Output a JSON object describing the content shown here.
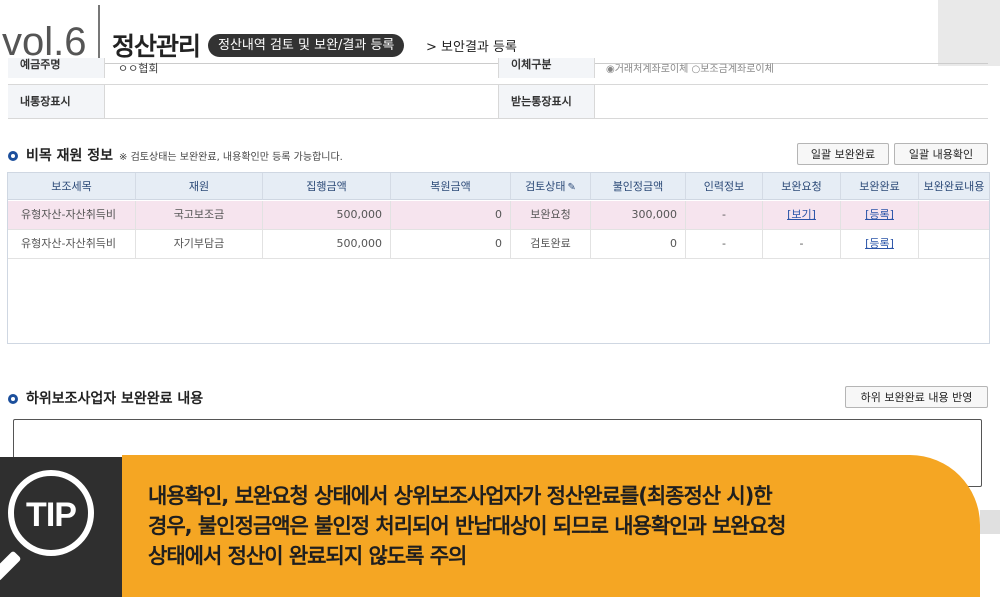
{
  "header": {
    "vol": "vol.6",
    "section": "정산관리",
    "pill": "정산내역 검토 및 보완/결과 등록",
    "crumb": "> 보안결과 등록"
  },
  "info_table": {
    "r1_label": "예금주명",
    "r1_value": "ㅇㅇ협회",
    "r1_label2": "이체구분",
    "r1_value2": "◉거래처계좌로이체 ○보조금계좌로이체",
    "r2_label": "내통장표시",
    "r2_value": "",
    "r2_label2": "받는통장표시",
    "r2_value2": ""
  },
  "budget_section": {
    "title": "비목 재원 정보",
    "note": "※ 검토상태는 보완완료, 내용확인만 등록 가능합니다.",
    "btn_bulk_complete": "일괄 보완완료",
    "btn_bulk_confirm": "일괄 내용확인",
    "columns": [
      "보조세목",
      "재원",
      "집행금액",
      "복원금액",
      "검토상태",
      "불인정금액",
      "인력정보",
      "보완요청",
      "보완완료",
      "보완완료내용"
    ],
    "sort_icon": "edit-icon",
    "rows": [
      {
        "subitem": "유형자산-자산취득비",
        "source": "국고보조금",
        "exec": "500,000",
        "restore": "0",
        "status": "보완요청",
        "disallowed": "300,000",
        "personnel": "-",
        "request": "[보기]",
        "complete": "[등록]",
        "content": ""
      },
      {
        "subitem": "유형자산-자산취득비",
        "source": "자기부담금",
        "exec": "500,000",
        "restore": "0",
        "status": "검토완료",
        "disallowed": "0",
        "personnel": "-",
        "request": "-",
        "complete": "[등록]",
        "content": ""
      }
    ],
    "highlight_color": "#f6e4ee"
  },
  "sub_section": {
    "title": "하위보조사업자 보완완료 내용",
    "btn_apply": "하위 보완완료 내용 반영"
  },
  "tip": {
    "badge": "TIP",
    "line1": "내용확인, 보완요청 상태에서 상위보조사업자가 정산완료를(최종정산 시)한",
    "line2": "경우, 불인정금액은 불인정 처리되어 반납대상이 되므로 내용확인과 보완요청",
    "line3": "상태에서 정산이 완료되지 않도록 주의",
    "accent": "#f5a623"
  }
}
